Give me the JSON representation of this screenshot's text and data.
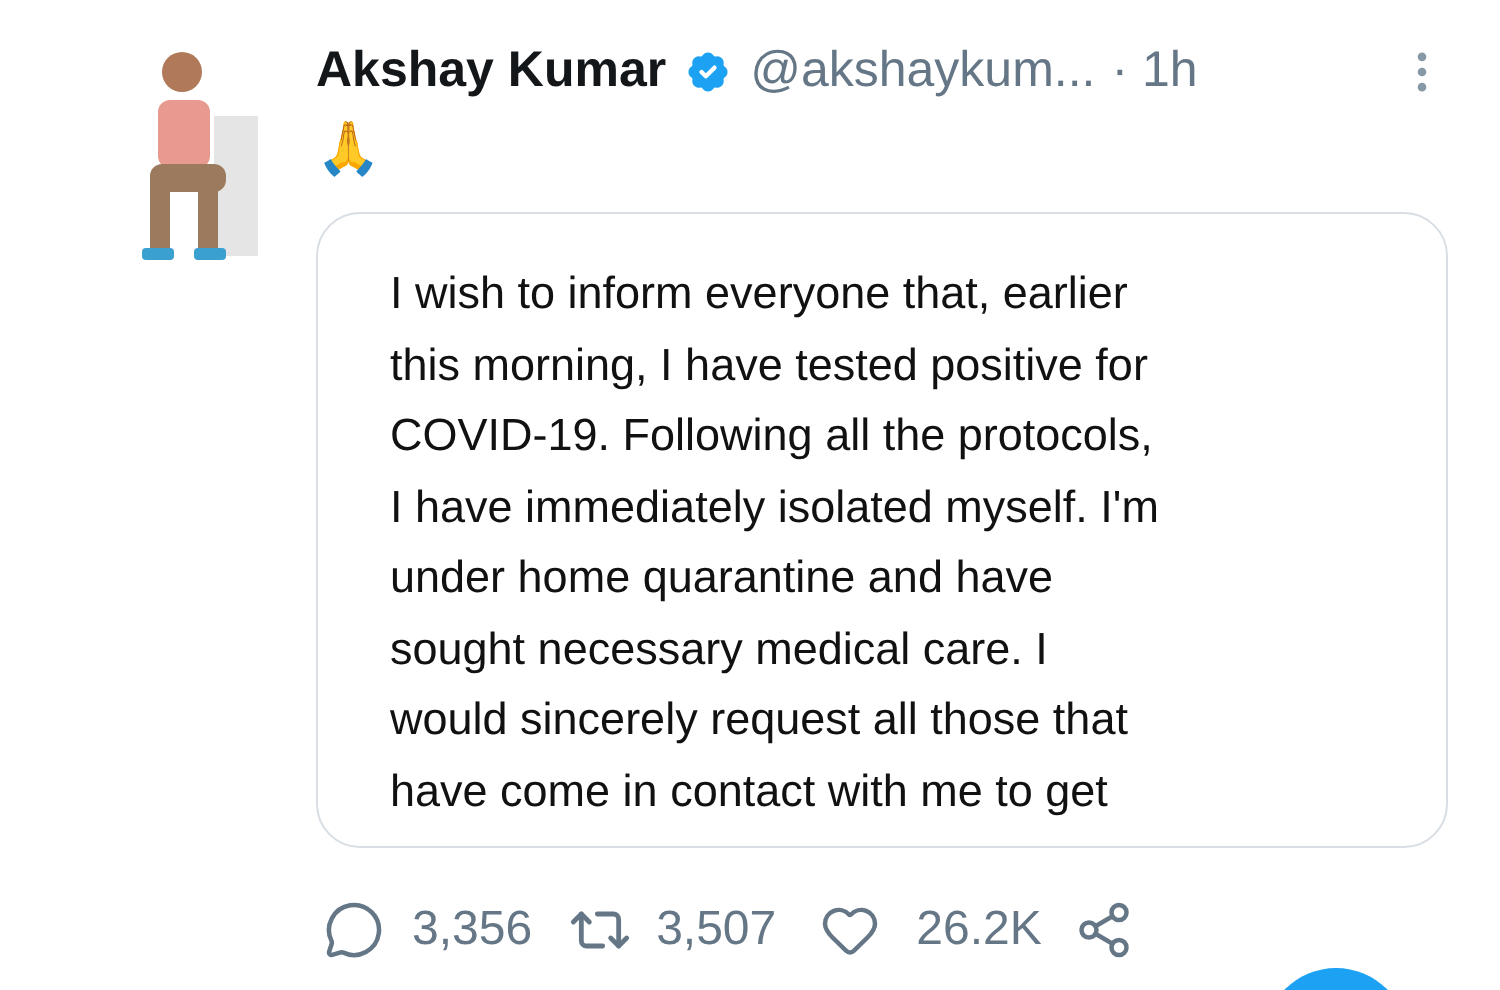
{
  "tweet": {
    "author": {
      "name": "Akshay Kumar",
      "verified": true,
      "handle": "@akshaykum...",
      "time": "· 1h"
    },
    "text": "🙏",
    "card": {
      "lines": [
        "I wish to inform everyone that, earlier",
        "this morning, I have tested positive for",
        "COVID-19. Following all the protocols,",
        "I have immediately isolated myself. I'm",
        "under home quarantine and have",
        "sought necessary medical care. I",
        "would sincerely request all those that",
        "have come in contact with me to get"
      ]
    },
    "actions": {
      "replies": "3,356",
      "retweets": "3,507",
      "likes": "26.2K"
    }
  }
}
